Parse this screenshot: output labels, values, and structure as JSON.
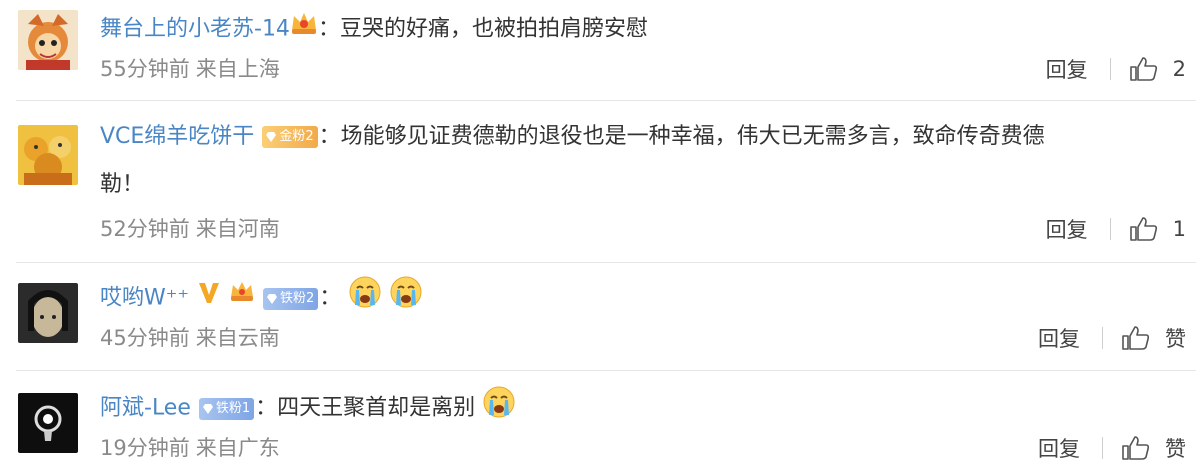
{
  "comments": [
    {
      "username": "舞台上的小老苏-14",
      "text": "：豆哭的好痛，也被拍拍肩膀安慰",
      "time": "55分钟前",
      "source": "来自上海",
      "reply_label": "回复",
      "like_label": "2",
      "badges": [
        "vip-crown"
      ]
    },
    {
      "username": "VCE绵羊吃饼干",
      "fan_badge": "金粉2",
      "text": "：场能够见证费德勒的退役也是一种幸福，伟大已无需多言，致命传奇费德",
      "text_line2": "勒！",
      "time": "52分钟前",
      "source": "来自河南",
      "reply_label": "回复",
      "like_label": "1"
    },
    {
      "username": "哎哟W⁺⁺",
      "verified": "V",
      "fan_badge": "铁粉2",
      "text": "：",
      "time": "45分钟前",
      "source": "来自云南",
      "reply_label": "回复",
      "like_label": "赞",
      "emojis": [
        "crying-emoji",
        "crying-emoji"
      ]
    },
    {
      "username": "阿斌-Lee",
      "fan_badge": "铁粉1",
      "text": "：四天王聚首却是离别",
      "time": "19分钟前",
      "source": "来自广东",
      "reply_label": "回复",
      "like_label": "赞",
      "emojis": [
        "crying-emoji"
      ]
    }
  ],
  "colors": {
    "username": "#4a86c5",
    "meta": "#8a8a8a",
    "divider": "#e6e6e6",
    "verified_v": "#f5a623"
  }
}
